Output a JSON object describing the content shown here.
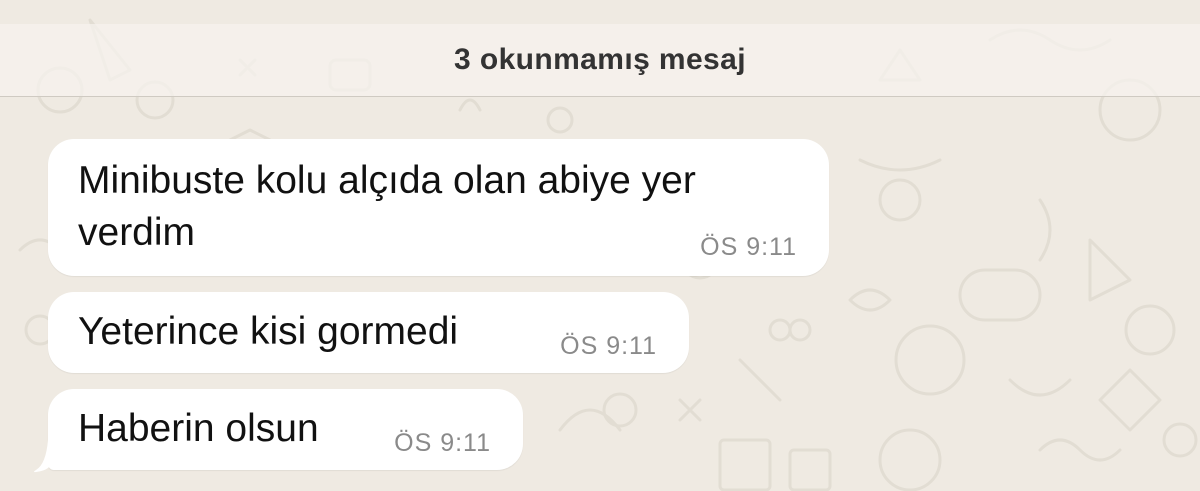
{
  "banner": {
    "unread_label": "3 okunmamış mesaj"
  },
  "messages": [
    {
      "line1": "Minibuste kolu alçıda olan abiye yer",
      "line2": "verdim",
      "time": "ÖS 9:11"
    },
    {
      "text": "Yeterince kisi gormedi",
      "time": "ÖS 9:11"
    },
    {
      "text": "Haberin olsun",
      "time": "ÖS 9:11"
    }
  ],
  "colors": {
    "background": "#efeae2",
    "bubble": "#ffffff",
    "time": "#8a8a8a",
    "text": "#111111"
  }
}
